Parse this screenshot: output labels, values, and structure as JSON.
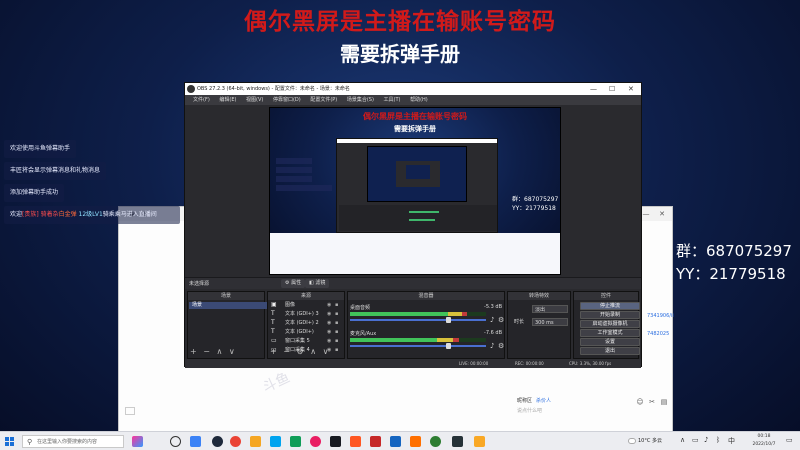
{
  "headline_red": "偶尔黑屏是主播在输账号密码",
  "headline_white": "需要拆弹手册",
  "notices": [
    {
      "text": "欢迎使用斗鱼弹幕助手"
    },
    {
      "text": "丰匠将会显示弹幕消息和礼物消息"
    },
    {
      "text": "添加弹幕助手成功"
    }
  ],
  "notice4": {
    "prefix": "欢迎",
    "name": "白金弹",
    "mid": "[贵族] 骑着杂",
    "lvl": "12级LV1",
    "suffix": "骑乘乘马进入直播间"
  },
  "group": {
    "qun": "群：687075297",
    "yy": "YY：21779518"
  },
  "chat_window": {
    "link1": "7341906/ii",
    "link2": "7482025",
    "user_label": "昵称区",
    "user_name": "杀价人",
    "hint": "说点什么吧"
  },
  "obs": {
    "title": "OBS 27.2.3 (64-bit, windows) - 配置文件：未命名 - 场景：未命名",
    "menu": [
      "文件(F)",
      "编辑(E)",
      "视图(V)",
      "停靠窗口(D)",
      "配置文件(P)",
      "场景集合(S)",
      "工具(T)",
      "帮助(H)"
    ],
    "selected_label": "未选择源",
    "tab_props": "属性",
    "tab_filters": "滤镜",
    "docks": {
      "scenes": "场景",
      "sources": "来源",
      "mixer": "混音器",
      "transitions": "转场特效",
      "controls": "控件"
    },
    "scene_item": "场景",
    "sources": [
      {
        "icon": "▣",
        "name": "图像"
      },
      {
        "icon": "T",
        "name": "文本 (GDI+) 3"
      },
      {
        "icon": "T",
        "name": "文本 (GDI+) 2"
      },
      {
        "icon": "T",
        "name": "文本 (GDI+)"
      },
      {
        "icon": "▭",
        "name": "窗口采集 5"
      },
      {
        "icon": "▭",
        "name": "窗口采集 4"
      }
    ],
    "mixer": [
      {
        "name": "桌面音频",
        "db": "-5.3 dB",
        "level": 0.72
      },
      {
        "name": "麦克风/Aux",
        "db": "-7.6 dB",
        "level": 0.64
      }
    ],
    "transition": {
      "value": "淡出",
      "duration_label": "时长",
      "duration_value": "300 ms"
    },
    "controls": [
      "停止推流",
      "开始录制",
      "启动虚拟摄像机",
      "工作室模式",
      "设置",
      "退出"
    ],
    "status": {
      "live": "LIVE: 00:00:00",
      "rec": "REC: 00:00:00",
      "cpu": "CPU: 3.3%, 30.00 fps"
    },
    "preview": {
      "headline_red": "偶尔黑屏是主播在输账号密码",
      "headline_white": "需要拆弹手册",
      "qun": "群：687075297",
      "yy": "YY：21779518"
    }
  },
  "watermark": "斗鱼",
  "taskbar": {
    "search_placeholder": "在这里输入你要搜索的内容",
    "weather": "10°C 多云",
    "time": "00:18",
    "date": "2022/10/7"
  }
}
